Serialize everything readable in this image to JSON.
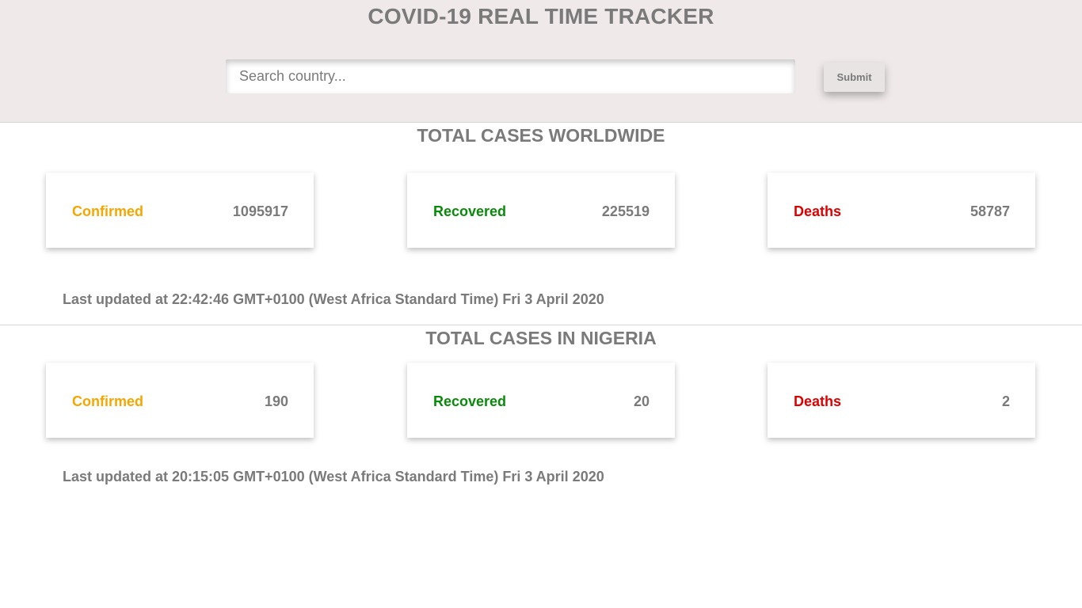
{
  "header": {
    "title": "COVID-19 REAL TIME TRACKER",
    "search_placeholder": "Search country...",
    "submit_label": "Submit"
  },
  "worldwide": {
    "title": "TOTAL CASES WORLDWIDE",
    "confirmed": {
      "label": "Confirmed",
      "value": "1095917"
    },
    "recovered": {
      "label": "Recovered",
      "value": "225519"
    },
    "deaths": {
      "label": "Deaths",
      "value": "58787"
    },
    "last_updated": "Last updated at 22:42:46 GMT+0100 (West Africa Standard Time) Fri 3 April 2020"
  },
  "country": {
    "title": "TOTAL CASES IN NIGERIA",
    "confirmed": {
      "label": "Confirmed",
      "value": "190"
    },
    "recovered": {
      "label": "Recovered",
      "value": "20"
    },
    "deaths": {
      "label": "Deaths",
      "value": "2"
    },
    "last_updated": "Last updated at 20:15:05 GMT+0100 (West Africa Standard Time) Fri 3 April 2020"
  },
  "colors": {
    "confirmed": "#f5a600",
    "recovered": "#0a8a0a",
    "deaths": "#e00000",
    "header_bg": "#efe9e9",
    "text": "#7a7a7a"
  }
}
